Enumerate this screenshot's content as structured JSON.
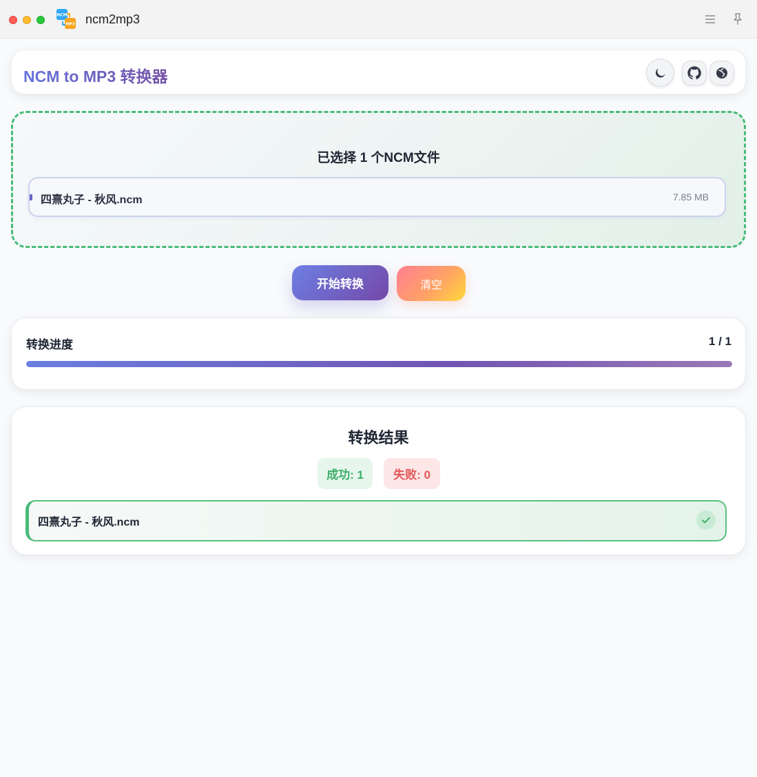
{
  "window": {
    "title": "ncm2mp3"
  },
  "header": {
    "title": "NCM to MP3 转换器"
  },
  "dropzone": {
    "title": "已选择 1 个NCM文件",
    "files": [
      {
        "name": "四熹丸子 - 秋风.ncm",
        "size": "7.85 MB"
      }
    ]
  },
  "actions": {
    "start_label": "开始转换",
    "clear_label": "清空"
  },
  "progress": {
    "label": "转换进度",
    "count": "1 / 1",
    "percent": 100
  },
  "results": {
    "title": "转换结果",
    "success_label": "成功: 1",
    "fail_label": "失败: 0",
    "items": [
      {
        "name": "四熹丸子 - 秋风.ncm",
        "status": "success"
      }
    ]
  },
  "colors": {
    "accent": "#6a63c7",
    "success": "#48bb78",
    "fail": "#e5575c"
  },
  "icons": {
    "titlebar": [
      "menu-icon",
      "pin-icon"
    ],
    "header": [
      "moon-icon",
      "github-icon",
      "globe-icon"
    ],
    "result": "check-icon"
  }
}
